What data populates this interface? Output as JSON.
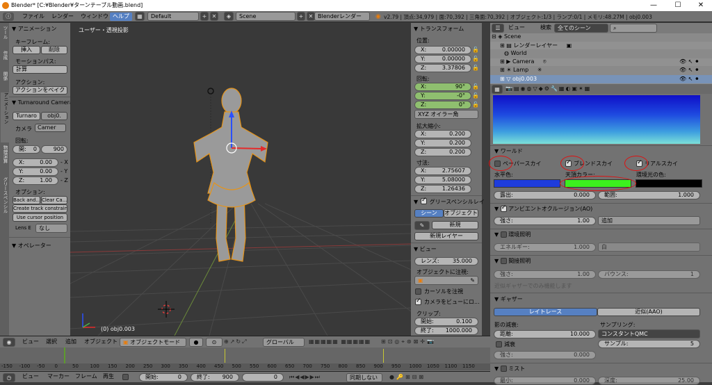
{
  "window": {
    "title": "Blender* [C:¥Blender¥ターンテーブル動画.blend]",
    "minimize": "—",
    "maximize": "☐",
    "close": "✕"
  },
  "infobar": {
    "menus": [
      "ファイル",
      "レンダー",
      "ウィンドウ",
      "ヘルプ"
    ],
    "layout": "Default",
    "scene": "Scene",
    "engine": "Blenderレンダー",
    "stats": "v2.79 | 頂点:34,979 | 面:70,392 | 三角面:70,392 | オブジェクト:1/3 | ランプ:0/1 | メモリ:48.27M | obj0.003"
  },
  "toolshelf": {
    "tabs": [
      "ツール",
      "作成",
      "関係",
      "アニメーション",
      "物理演算",
      "グリースペンシル"
    ],
    "animation_header": "アニメーション",
    "keyframe_label": "キーフレーム:",
    "insert": "挿入",
    "delete": "削除",
    "motion_path_label": "モーションパス:",
    "calculate": "計算",
    "action_label": "アクション:",
    "bake_action": "アクションをベイク",
    "turnaround_header": "Turnaround Camera",
    "turnaround_btn": "Turnaro",
    "obj_field": "obj0.",
    "camera_label": "カメラ",
    "camera_field": "Camer",
    "rotation_label": "回転:",
    "start_label": "開:",
    "start_val": "0",
    "end_val": "900",
    "x_label": "X:",
    "x_val": "0.00",
    "y_label": "Y:",
    "y_val": "0.00",
    "z_label": "Z:",
    "z_val": "1.00",
    "neg_x": "- X",
    "neg_y": "- Y",
    "neg_z": "- Z",
    "options_label": "オプション:",
    "back_btn": "Back and...",
    "clear_btn": "Clear Ca...",
    "create_track": "Create track constraint",
    "use_cursor": "Use cursor position",
    "lens_label": "Lens E",
    "lens_val": "なし",
    "operator_header": "オペレーター"
  },
  "viewport": {
    "label": "ユーザー・透視投影",
    "object_label": "(0) obj0.003"
  },
  "npanel": {
    "transform_header": "トランスフォーム",
    "location_label": "位置:",
    "loc": [
      {
        "a": "X:",
        "v": "0.00000"
      },
      {
        "a": "Y:",
        "v": "0.00000"
      },
      {
        "a": "Z:",
        "v": "3.37806"
      }
    ],
    "rotation_label": "回転:",
    "rot": [
      {
        "a": "X:",
        "v": "90°"
      },
      {
        "a": "Y:",
        "v": "-0°"
      },
      {
        "a": "Z:",
        "v": "0°"
      }
    ],
    "rot_mode": "XYZ オイラー角",
    "scale_label": "拡大縮小:",
    "scale": [
      {
        "a": "X:",
        "v": "0.200"
      },
      {
        "a": "Y:",
        "v": "0.200"
      },
      {
        "a": "Z:",
        "v": "0.200"
      }
    ],
    "dims_label": "寸法:",
    "dims": [
      {
        "a": "X:",
        "v": "2.75607"
      },
      {
        "a": "Y:",
        "v": "5.08000"
      },
      {
        "a": "Z:",
        "v": "1.26436"
      }
    ],
    "grease_header": "グリースペンシルレイ",
    "scene_tab": "シーン",
    "object_tab": "オブジェクト",
    "new_btn": "新規",
    "new_layer": "新規レイヤー",
    "view_header": "ビュー",
    "lens_label": "レンズ:",
    "lens_val": "35.000",
    "lock_label": "オブジェクトに注視:",
    "cursor_lock": "カーソルを注視",
    "camera_lock": "カメラをビューにロ...",
    "clip_label": "クリップ:",
    "clip_start_l": "開始:",
    "clip_start": "0.100",
    "clip_end_l": "終了:",
    "clip_end": "1000.000"
  },
  "outliner": {
    "view": "ビュー",
    "search": "検索",
    "filter": "全てのシーン",
    "items": [
      "Scene",
      "レンダーレイヤー",
      "World",
      "Camera",
      "Lamp",
      "obj0.003"
    ]
  },
  "properties": {
    "world_header": "ワールド",
    "paper_sky": "ペーパースカイ",
    "blend_sky": "ブレンドスカイ",
    "real_sky": "リアルスカイ",
    "horizon_label": "水平色:",
    "zenith_label": "天頂カラー:",
    "ambient_label": "環境光の色:",
    "exposure_l": "露出:",
    "exposure": "0.000",
    "range_l": "範囲:",
    "range": "1.000",
    "ao_header": "アンビエントオクルージョン(AO)",
    "ao_strength_l": "強さ:",
    "ao_strength": "1.00",
    "ao_mode": "追加",
    "env_header": "環境照明",
    "energy_l": "エネルギー:",
    "energy": "1.000",
    "env_color": "白",
    "indirect_header": "間接照明",
    "ind_strength_l": "強さ:",
    "ind_strength": "1.00",
    "bounce_l": "バウンス:",
    "bounce": "1",
    "indirect_note": "近似ギャザーでのみ機能します",
    "gather_header": "ギャザー",
    "raytrace": "レイトレース",
    "approx": "近似(AAO)",
    "attenuation_l": "影の減衰:",
    "sampling_l": "サンプリング:",
    "distance_l": "距離:",
    "distance": "10.000",
    "sampling": "コンスタントQMC",
    "falloff": "減衰",
    "samples_l": "サンプル:",
    "samples": "5",
    "strength2_l": "強さ:",
    "strength2": "0.000",
    "mist_header": "ミスト",
    "mist_min_l": "最小:",
    "mist_min": "0.000",
    "mist_depth_l": "深度:",
    "mist_depth": "25.00"
  },
  "viewheader": {
    "view": "ビュー",
    "select": "選択",
    "add": "追加",
    "object": "オブジェクト",
    "mode": "オブジェクトモード",
    "global": "グローバル"
  },
  "timeline": {
    "ticks": [
      "-150",
      "-100",
      "-50",
      "0",
      "50",
      "100",
      "150",
      "200",
      "250",
      "300",
      "350",
      "400",
      "450",
      "500",
      "550",
      "600",
      "650",
      "700",
      "750",
      "800",
      "850",
      "900",
      "950",
      "1000",
      "1050",
      "1100",
      "1150"
    ],
    "view": "ビュー",
    "marker": "マーカー",
    "frame": "フレーム",
    "play": "再生",
    "start_l": "開始:",
    "start": "0",
    "end_l": "終了:",
    "end": "900",
    "current": "0",
    "sync": "同期しない"
  },
  "colors": {
    "horizon": "#1e3cdc",
    "zenith": "#3cf01e",
    "ambient": "#000000",
    "accent": "#5680c2"
  }
}
